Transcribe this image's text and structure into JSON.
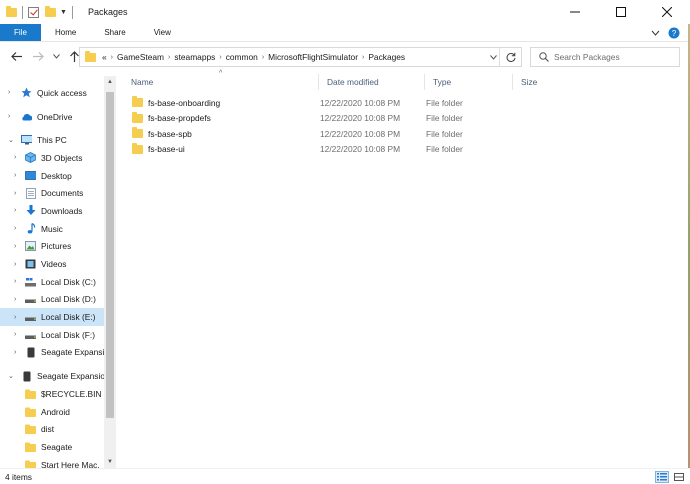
{
  "window": {
    "title": "Packages"
  },
  "ribbon": {
    "tabs": [
      {
        "label": "File"
      },
      {
        "label": "Home"
      },
      {
        "label": "Share"
      },
      {
        "label": "View"
      }
    ]
  },
  "address": {
    "overflow": "«",
    "crumbs": [
      "GameSteam",
      "steamapps",
      "common",
      "MicrosoftFlightSimulator",
      "Packages"
    ]
  },
  "search": {
    "placeholder": "Search Packages"
  },
  "sidebar": {
    "items": [
      {
        "label": "Quick access",
        "icon": "star-icon"
      },
      {
        "label": "OneDrive",
        "icon": "cloud-icon"
      },
      {
        "label": "This PC",
        "icon": "monitor-icon"
      },
      {
        "label": "3D Objects",
        "icon": "cube-icon"
      },
      {
        "label": "Desktop",
        "icon": "desktop-icon"
      },
      {
        "label": "Documents",
        "icon": "document-icon"
      },
      {
        "label": "Downloads",
        "icon": "download-arrow-icon"
      },
      {
        "label": "Music",
        "icon": "music-note-icon"
      },
      {
        "label": "Pictures",
        "icon": "picture-icon"
      },
      {
        "label": "Videos",
        "icon": "film-icon"
      },
      {
        "label": "Local Disk (C:)",
        "icon": "system-drive-icon"
      },
      {
        "label": "Local Disk (D:)",
        "icon": "drive-icon"
      },
      {
        "label": "Local Disk (E:)",
        "icon": "drive-icon"
      },
      {
        "label": "Local Disk (F:)",
        "icon": "drive-icon"
      },
      {
        "label": "Seagate Expansion",
        "icon": "external-drive-icon"
      },
      {
        "label": "Seagate Expansion",
        "icon": "external-drive-icon"
      },
      {
        "label": "$RECYCLE.BIN",
        "icon": "folder-icon"
      },
      {
        "label": "Android",
        "icon": "folder-icon"
      },
      {
        "label": "dist",
        "icon": "folder-icon"
      },
      {
        "label": "Seagate",
        "icon": "folder-icon"
      },
      {
        "label": "Start Here Mac.",
        "icon": "folder-icon"
      }
    ]
  },
  "columns": {
    "name": "Name",
    "date": "Date modified",
    "type": "Type",
    "size": "Size"
  },
  "files": [
    {
      "name": "fs-base-onboarding",
      "date": "12/22/2020 10:08 PM",
      "type": "File folder"
    },
    {
      "name": "fs-base-propdefs",
      "date": "12/22/2020 10:08 PM",
      "type": "File folder"
    },
    {
      "name": "fs-base-spb",
      "date": "12/22/2020 10:08 PM",
      "type": "File folder"
    },
    {
      "name": "fs-base-ui",
      "date": "12/22/2020 10:08 PM",
      "type": "File folder"
    }
  ],
  "status": {
    "count": "4 items"
  },
  "colors": {
    "accent": "#1979ca",
    "selection": "#cce4f7",
    "folder": "#f5cd4f"
  }
}
